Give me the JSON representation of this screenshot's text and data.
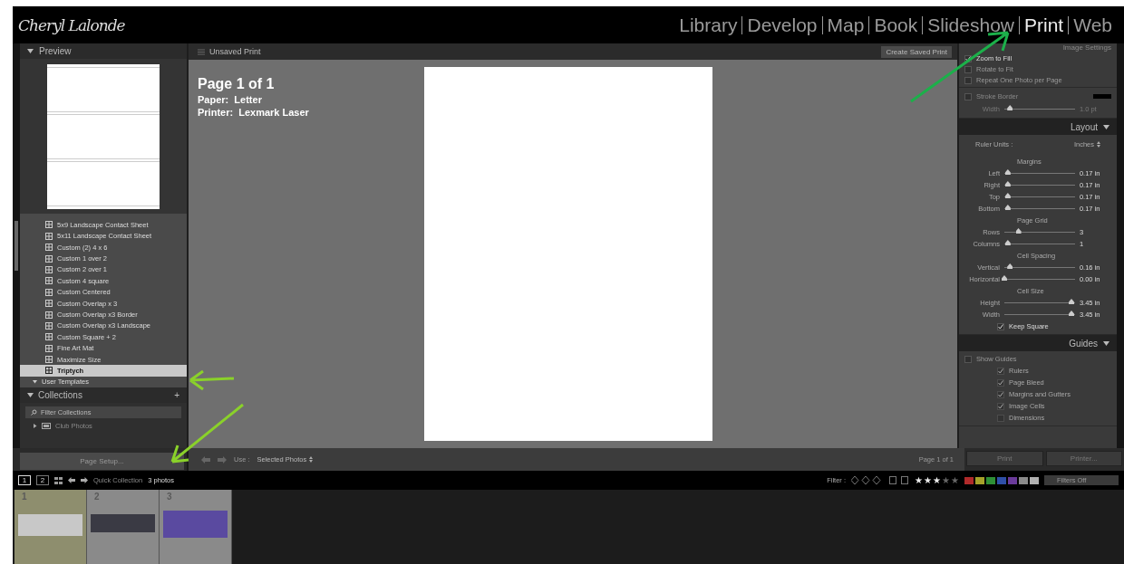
{
  "logo": {
    "text": "Cheryl Lalonde"
  },
  "modules": [
    {
      "label": "Library",
      "selected": false
    },
    {
      "label": "Develop",
      "selected": false
    },
    {
      "label": "Map",
      "selected": false
    },
    {
      "label": "Book",
      "selected": false
    },
    {
      "label": "Slideshow",
      "selected": false
    },
    {
      "label": "Print",
      "selected": true
    },
    {
      "label": "Web",
      "selected": false
    }
  ],
  "left_panel": {
    "preview_title": "Preview",
    "templates": [
      {
        "label": "5x9 Landscape Contact Sheet",
        "selected": false
      },
      {
        "label": "5x11 Landscape Contact Sheet",
        "selected": false
      },
      {
        "label": "Custom (2) 4 x 6",
        "selected": false
      },
      {
        "label": "Custom 1 over 2",
        "selected": false
      },
      {
        "label": "Custom 2 over 1",
        "selected": false
      },
      {
        "label": "Custom 4 square",
        "selected": false
      },
      {
        "label": "Custom Centered",
        "selected": false
      },
      {
        "label": "Custom Overlap x 3",
        "selected": false
      },
      {
        "label": "Custom Overlap x3 Border",
        "selected": false
      },
      {
        "label": "Custom Overlap x3 Landscape",
        "selected": false
      },
      {
        "label": "Custom Square + 2",
        "selected": false
      },
      {
        "label": "Fine Art Mat",
        "selected": false
      },
      {
        "label": "Maximize Size",
        "selected": false
      },
      {
        "label": "Triptych",
        "selected": true
      }
    ],
    "user_templates": {
      "label": "User Templates",
      "expanded": true
    },
    "collections_title": "Collections",
    "collections_add": "+",
    "filter": {
      "placeholder": "Filter Collections"
    },
    "collection_items": [
      {
        "label": "Club Photos",
        "expanded": false
      }
    ],
    "page_setup": "Page Setup..."
  },
  "center": {
    "title": "Unsaved Print",
    "create_button": "Create Saved Print",
    "info": {
      "page": "Page 1 of 1",
      "paper_label": "Paper:",
      "paper": "Letter",
      "printer_label": "Printer:",
      "printer": "Lexmark Laser"
    },
    "toolbar": {
      "use_label": "Use :",
      "use_value": "Selected Photos",
      "page_count": "Page 1 of 1"
    }
  },
  "right_panel": {
    "image_settings": {
      "title": "Image Settings",
      "options": [
        {
          "label": "Zoom to Fill",
          "checked": true
        },
        {
          "label": "Rotate to Fit",
          "checked": false
        },
        {
          "label": "Repeat One Photo per Page",
          "checked": false
        }
      ],
      "stroke": {
        "label": "Stroke Border",
        "checked": false,
        "width_label": "Width",
        "level": 0.08,
        "reading": "1.0 pt"
      }
    },
    "layout": {
      "title": "Layout",
      "ruler_label": "Ruler Units :",
      "ruler_value": "Inches",
      "groups": [
        {
          "title": "Margins",
          "rows": [
            {
              "label": "Left",
              "level": 0.05,
              "reading": "0.17 in"
            },
            {
              "label": "Right",
              "level": 0.05,
              "reading": "0.17 in"
            },
            {
              "label": "Top",
              "level": 0.05,
              "reading": "0.17 in"
            },
            {
              "label": "Bottom",
              "level": 0.05,
              "reading": "0.17 in"
            }
          ]
        },
        {
          "title": "Page Grid",
          "rows": [
            {
              "label": "Rows",
              "level": 0.2,
              "reading": "3"
            },
            {
              "label": "Columns",
              "level": 0.05,
              "reading": "1"
            }
          ]
        },
        {
          "title": "Cell Spacing",
          "rows": [
            {
              "label": "Vertical",
              "level": 0.08,
              "reading": "0.16 in"
            },
            {
              "label": "Horizontal",
              "level": 0,
              "reading": "0.00 in"
            }
          ]
        },
        {
          "title": "Cell Size",
          "rows": [
            {
              "label": "Height",
              "level": 0.95,
              "reading": "3.45 in"
            },
            {
              "label": "Width",
              "level": 0.95,
              "reading": "3.45 in"
            }
          ]
        }
      ],
      "keep_square": {
        "label": "Keep Square",
        "checked": true
      }
    },
    "guides": {
      "title": "Guides",
      "show_guides": {
        "label": "Show Guides",
        "checked": false
      },
      "options": [
        {
          "label": "Rulers",
          "checked": true
        },
        {
          "label": "Page Bleed",
          "checked": true
        },
        {
          "label": "Margins and Gutters",
          "checked": true
        },
        {
          "label": "Image Cells",
          "checked": true
        },
        {
          "label": "Dimensions",
          "checked": false
        }
      ]
    },
    "buttons": [
      "Print",
      "Printer..."
    ]
  },
  "filmstrip": {
    "views": [
      {
        "label": "1",
        "selected": true
      },
      {
        "label": "2",
        "selected": false
      }
    ],
    "source": "Quick Collection",
    "count": "3 photos",
    "filter_label": "Filter :",
    "stars": 3,
    "color_labels": [
      {
        "color": "#b02a2a"
      },
      {
        "color": "#a6a22a"
      },
      {
        "color": "#2e8f36"
      },
      {
        "color": "#2f4fa8"
      },
      {
        "color": "#6a3a9a"
      },
      {
        "color": "#8a8a8a"
      },
      {
        "color": "#b0b0b0"
      }
    ],
    "filter_preset": "Filters Off",
    "thumbnails": [
      {
        "number": "1",
        "selected": true
      },
      {
        "number": "2",
        "selected": false
      },
      {
        "number": "3",
        "selected": false
      }
    ]
  }
}
